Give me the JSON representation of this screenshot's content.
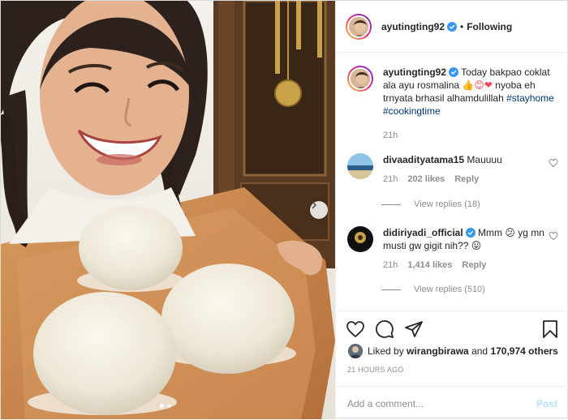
{
  "post": {
    "author": "ayutingting92",
    "follow_status": "Following",
    "separator": "•",
    "caption": {
      "user": "ayutingting92",
      "text_1": "Today bakpao coklat ala ayu rosmalina",
      "emoji_1": "👍😊❤",
      "text_2": "nyoba eh trnyata brhasil alhamdulillah",
      "hashtag_1": "#stayhome",
      "hashtag_2": "#cookingtime",
      "time": "21h"
    },
    "comments": [
      {
        "user": "divaaditya tama15",
        "user_display": "divaadityatama15",
        "text": "Mauuuu",
        "time": "21h",
        "likes": "202 likes",
        "reply_label": "Reply",
        "view_replies": "View replies (18)"
      },
      {
        "user_display": "didiriyadi_official",
        "text": "Mmm 😕 yg mn musti gw gigit nih?? 😛",
        "time": "21h",
        "likes": "1,414 likes",
        "reply_label": "Reply",
        "view_replies": "View replies (510)"
      }
    ],
    "likes": {
      "prefix": "Liked by",
      "first_user": "wirangbirawa",
      "joiner": "and",
      "others": "170,974 others"
    },
    "timestamp": "21 HOURS AGO",
    "add_comment_placeholder": "Add a comment...",
    "post_button": "Post"
  },
  "carousel": {
    "total_slides": 2,
    "current_slide": 1
  },
  "icons": {
    "verified": "verified-badge-icon",
    "like": "heart-icon",
    "comment": "comment-icon",
    "share": "share-icon",
    "save": "bookmark-icon",
    "next": "chevron-right-icon"
  },
  "colors": {
    "verified": "#3897f0",
    "link": "#00376b",
    "muted": "#8e8e8e",
    "post_disabled": "#b2dffc",
    "heart_red": "#ed4956"
  }
}
